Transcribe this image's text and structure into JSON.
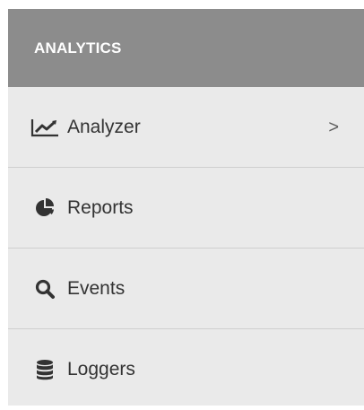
{
  "header": {
    "title": "ANALYTICS"
  },
  "menu": {
    "items": [
      {
        "label": "Analyzer",
        "icon": "line-chart-icon",
        "has_submenu": true,
        "chevron": ">"
      },
      {
        "label": "Reports",
        "icon": "pie-chart-icon",
        "has_submenu": false
      },
      {
        "label": "Events",
        "icon": "search-icon",
        "has_submenu": false
      },
      {
        "label": "Loggers",
        "icon": "database-icon",
        "has_submenu": false
      }
    ]
  },
  "colors": {
    "header_bg": "#8c8c8c",
    "panel_bg": "#eaeaea",
    "text": "#333333",
    "divider": "#cfcfcf"
  }
}
